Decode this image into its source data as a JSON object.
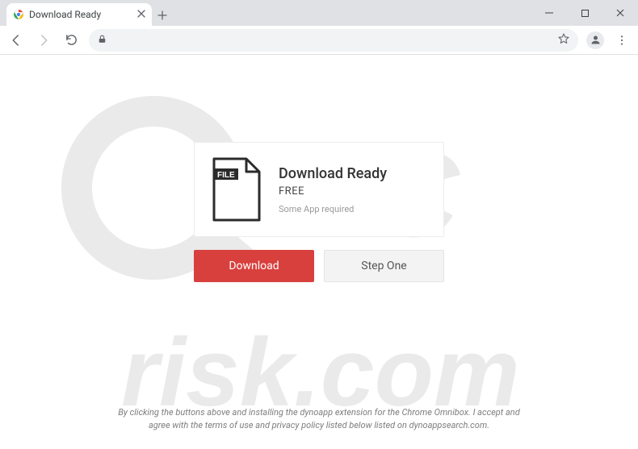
{
  "browser": {
    "tab_title": "Download Ready"
  },
  "page": {
    "card": {
      "title": "Download Ready",
      "price": "FREE",
      "requirement": "Some App required"
    },
    "buttons": {
      "primary": "Download",
      "secondary": "Step One"
    },
    "disclaimer": "By clicking the buttons above and installing the dynoapp extension for the Chrome Omnibox. I accept and agree with the terms of use and privacy policy listed below listed on dynoappsearch.com."
  }
}
